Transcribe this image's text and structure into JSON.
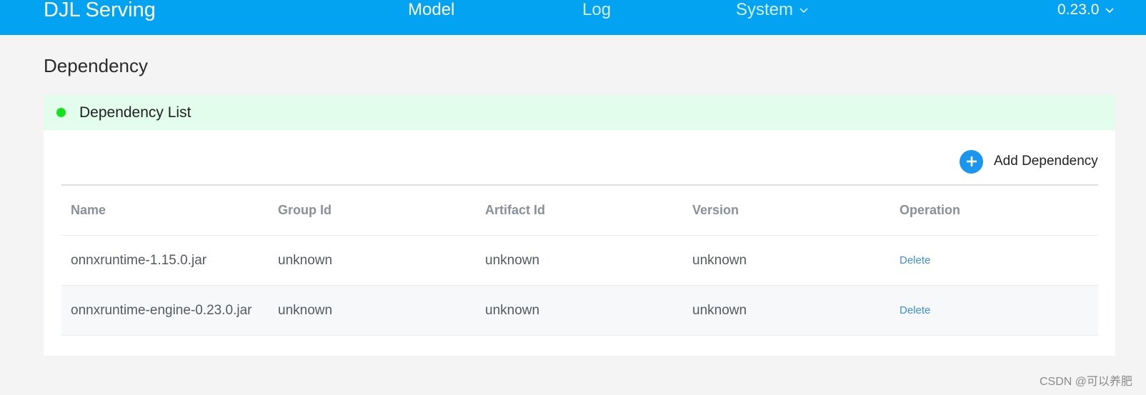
{
  "navbar": {
    "brand": "DJL Serving",
    "items": [
      {
        "label": "Model"
      },
      {
        "label": "Log"
      },
      {
        "label": "System"
      }
    ],
    "version": "0.23.0",
    "bg_color": "#03a3f2"
  },
  "page": {
    "title": "Dependency"
  },
  "card": {
    "title": "Dependency List",
    "status_color": "#13e31b",
    "add_button_label": "Add Dependency"
  },
  "table": {
    "columns": [
      "Name",
      "Group Id",
      "Artifact Id",
      "Version",
      "Operation"
    ],
    "rows": [
      {
        "name": "onnxruntime-1.15.0.jar",
        "group_id": "unknown",
        "artifact_id": "unknown",
        "version": "unknown",
        "operation": "Delete"
      },
      {
        "name": "onnxruntime-engine-0.23.0.jar",
        "group_id": "unknown",
        "artifact_id": "unknown",
        "version": "unknown",
        "operation": "Delete"
      }
    ]
  },
  "watermark": "CSDN @可以养肥",
  "icons": {
    "system_dropdown": "chevron-down-icon",
    "version_dropdown": "chevron-down-icon",
    "add": "plus-circle-icon",
    "status": "status-dot"
  }
}
